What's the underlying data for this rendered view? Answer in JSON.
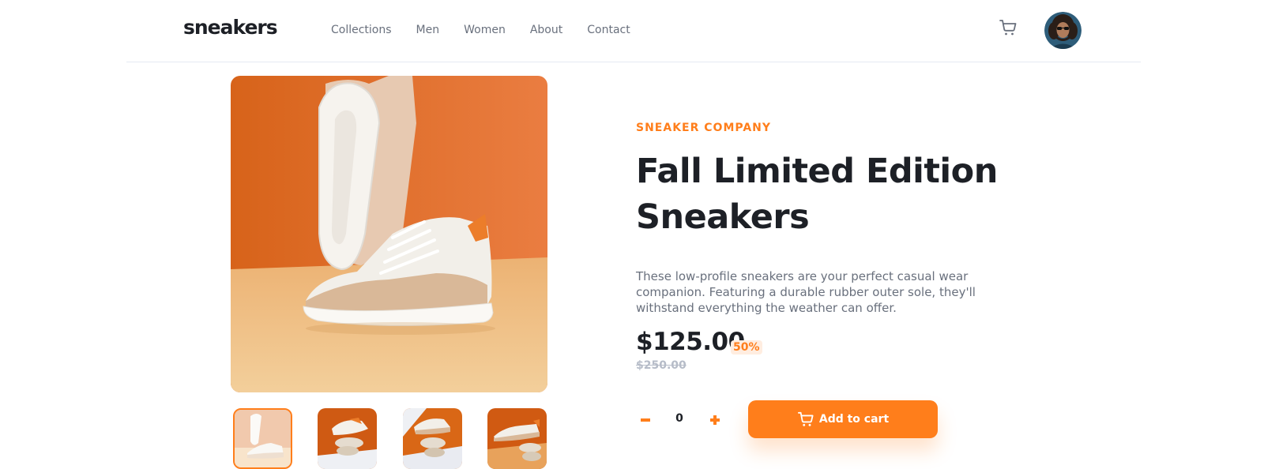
{
  "header": {
    "logo": "sneakers",
    "nav": [
      "Collections",
      "Men",
      "Women",
      "About",
      "Contact"
    ],
    "cart_icon": "cart-icon",
    "avatar_icon": "avatar"
  },
  "gallery": {
    "thumbnails": [
      "thumbnail-1",
      "thumbnail-2",
      "thumbnail-3",
      "thumbnail-4"
    ],
    "active_index": 0
  },
  "product": {
    "company": "SNEAKER COMPANY",
    "title_line1": "Fall Limited Edition",
    "title_line2": "Sneakers",
    "description_line1": "These low-profile sneakers are your perfect casual wear",
    "description_line2": "companion. Featuring a durable rubber outer sole, they'll",
    "description_line3": "withstand everything the weather can offer.",
    "price": "$125.00",
    "discount": "50%",
    "old_price": "$250.00",
    "quantity": "0",
    "add_to_cart": "Add to cart"
  },
  "colors": {
    "accent": "#ff7e1b",
    "accent_pale": "#ffede0",
    "dark": "#1d2026",
    "grey": "#69707d"
  }
}
